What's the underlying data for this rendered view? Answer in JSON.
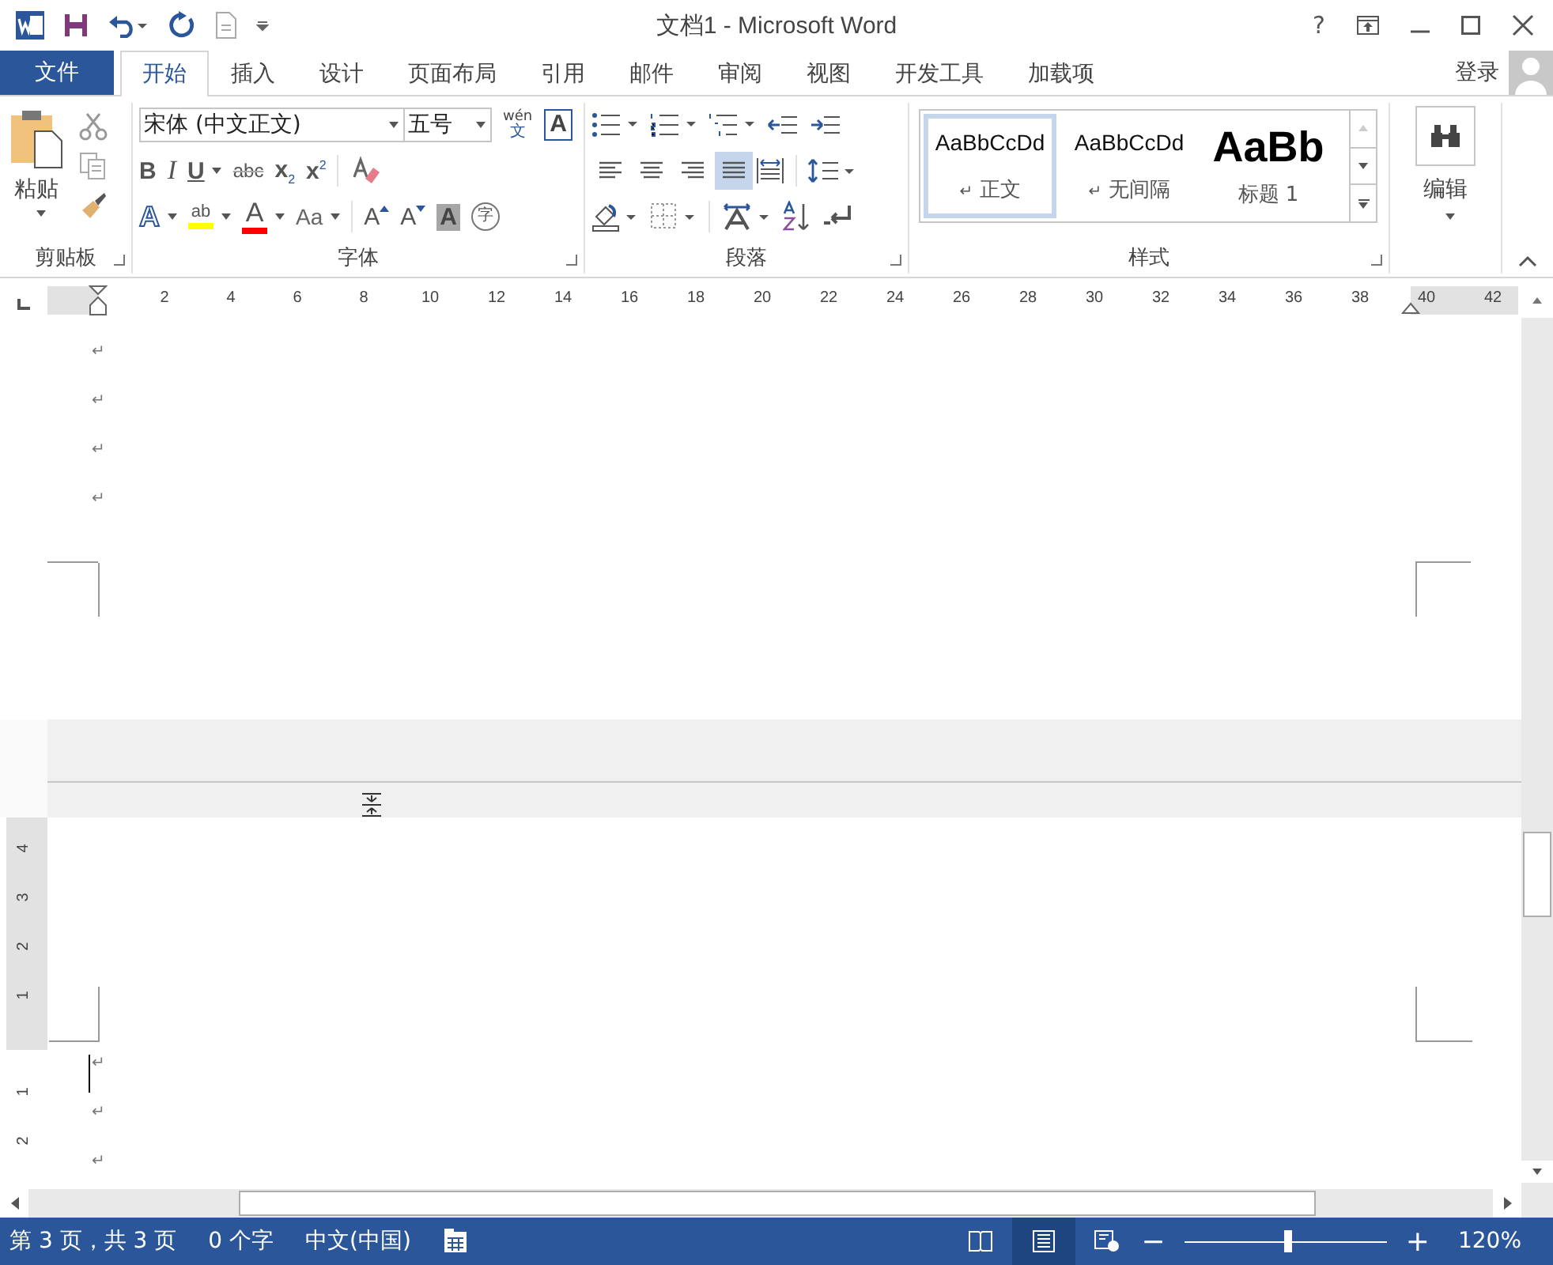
{
  "window": {
    "title": "文档1 - Microsoft Word",
    "help": "?"
  },
  "ribbon_tabs": {
    "file": "文件",
    "account": "登录",
    "tabs": [
      {
        "label": "开始",
        "selected": true
      },
      {
        "label": "插入",
        "selected": false
      },
      {
        "label": "设计",
        "selected": false
      },
      {
        "label": "页面布局",
        "selected": false
      },
      {
        "label": "引用",
        "selected": false
      },
      {
        "label": "邮件",
        "selected": false
      },
      {
        "label": "审阅",
        "selected": false
      },
      {
        "label": "视图",
        "selected": false
      },
      {
        "label": "开发工具",
        "selected": false
      },
      {
        "label": "加载项",
        "selected": false
      }
    ]
  },
  "clipboard": {
    "paste": "粘贴",
    "label": "剪贴板"
  },
  "font": {
    "name": "宋体 (中文正文)",
    "size": "五号",
    "phonetic_guide": [
      "wén",
      "文"
    ],
    "border_letter": "A",
    "label": "字体",
    "row_2": [
      {
        "kind": "bold",
        "text": "B",
        "dropdown": false
      },
      {
        "kind": "italic",
        "text": "I",
        "dropdown": false
      },
      {
        "kind": "underline",
        "text": "U",
        "dropdown": true
      },
      {
        "kind": "strike",
        "text": "abc",
        "dropdown": false
      },
      {
        "kind": "subscript",
        "text": "x$_{2}$",
        "dropdown": false
      },
      {
        "kind": "superscript",
        "text": "x$^{2}$",
        "dropdown": false
      }
    ],
    "row_3": [
      {
        "kind": "effects",
        "text": "A",
        "dropdown": true
      },
      {
        "kind": "highlight",
        "text": "ab",
        "dropdown": true,
        "color": "#ffff00"
      },
      {
        "kind": "font_color",
        "text": "A",
        "dropdown": true,
        "color": "#ff0000"
      },
      {
        "kind": "case",
        "text": "Aa",
        "dropdown": true
      },
      {
        "kind": "grow",
        "text": "A",
        "dropdown": false
      },
      {
        "kind": "shrink",
        "text": "A",
        "dropdown": false
      },
      {
        "kind": "shading",
        "text": "A",
        "dropdown": false
      },
      {
        "kind": "enclose",
        "text": "字",
        "dropdown": false
      }
    ]
  },
  "paragraph": {
    "label": "段落",
    "alignments": [
      {
        "kind": "left",
        "selected": false
      },
      {
        "kind": "center",
        "selected": false
      },
      {
        "kind": "right",
        "selected": false
      },
      {
        "kind": "justify",
        "selected": true
      }
    ]
  },
  "styles": {
    "label": "样式",
    "items": [
      {
        "kind": "body",
        "preview": "AaBbCcDd",
        "mark": "↵",
        "name": "正文",
        "selected": true
      },
      {
        "kind": "body",
        "preview": "AaBbCcDd",
        "mark": "↵",
        "name": "无间隔",
        "selected": false
      },
      {
        "kind": "heading",
        "preview": "AaBb",
        "name": "标题 1",
        "selected": false
      }
    ]
  },
  "editing": {
    "label": "编辑"
  },
  "ruler": {
    "numbers": [
      "2",
      "4",
      "6",
      "8",
      "10",
      "12",
      "14",
      "16",
      "18",
      "20",
      "22",
      "24",
      "26",
      "28",
      "30",
      "32",
      "34",
      "36",
      "38",
      "40",
      "42"
    ]
  },
  "vertical_ruler": {
    "numbers": [
      "4",
      "3",
      "2",
      "1",
      "1",
      "2"
    ]
  },
  "document": {
    "page_1_marks": [
      "↵",
      "↵",
      "↵",
      "↵"
    ],
    "page_3_marks": [
      "↵",
      "↵",
      "↵"
    ]
  },
  "status_bar": {
    "page": "第 3 页，共 3 页",
    "words": "0 个字",
    "language": "中文(中国)",
    "views": [
      {
        "kind": "read",
        "selected": false
      },
      {
        "kind": "print",
        "selected": true
      },
      {
        "kind": "web",
        "selected": false
      }
    ],
    "zoom_out": "−",
    "zoom_in": "+",
    "zoom": {
      "level": 0.52
    },
    "zoom_percent": "120%"
  }
}
